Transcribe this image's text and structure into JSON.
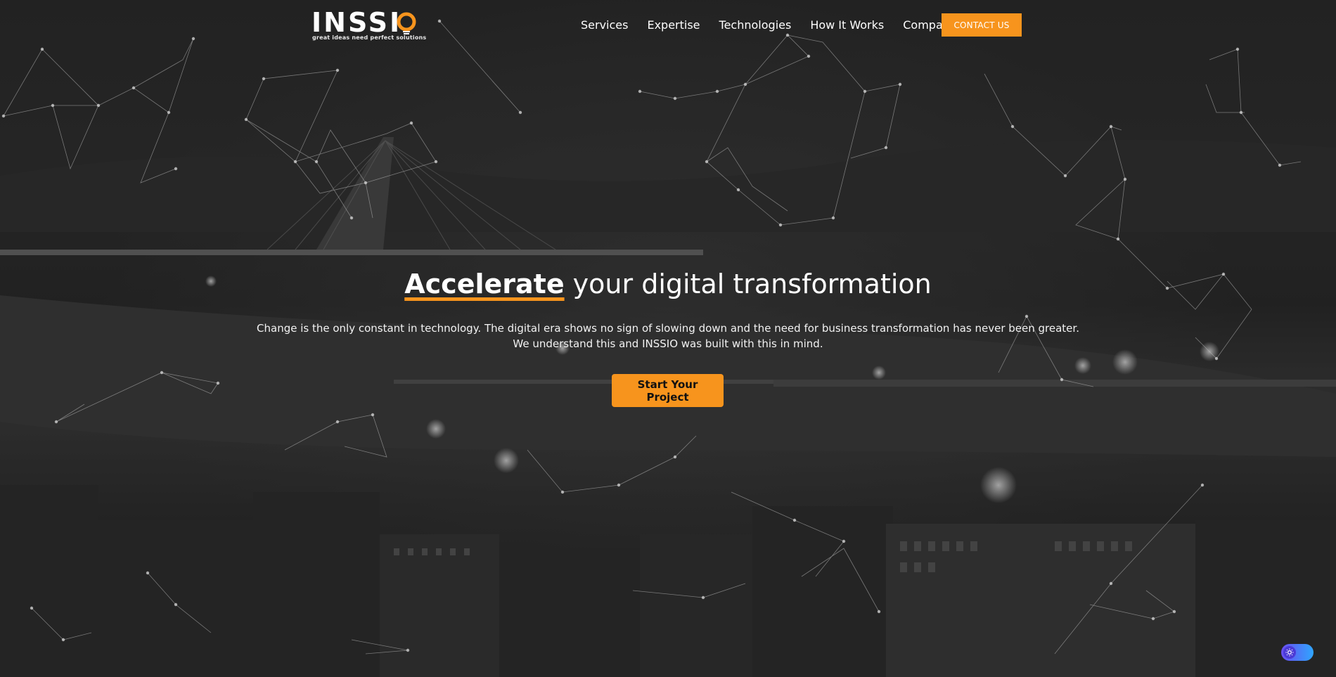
{
  "brand": {
    "name": "INSSI",
    "last_letter": "O",
    "tagline": "great ideas need perfect solutions",
    "accent_color": "#f7941d"
  },
  "nav": {
    "items": [
      {
        "label": "Services"
      },
      {
        "label": "Expertise"
      },
      {
        "label": "Technologies"
      },
      {
        "label": "How It Works"
      },
      {
        "label": "Company"
      }
    ],
    "contact_label": "CONTACT US"
  },
  "hero": {
    "headline_accent": "Accelerate",
    "headline_rest": " your digital transformation",
    "subtext_line1": "Change is the only constant in technology. The digital era shows no sign of slowing down and the need for business transformation has never been greater.",
    "subtext_line2": "We understand this and INSSIO was built with this in mind.",
    "cta_label": "Start Your Project"
  },
  "widgets": {
    "theme_toggle_icon": "sun-icon"
  }
}
